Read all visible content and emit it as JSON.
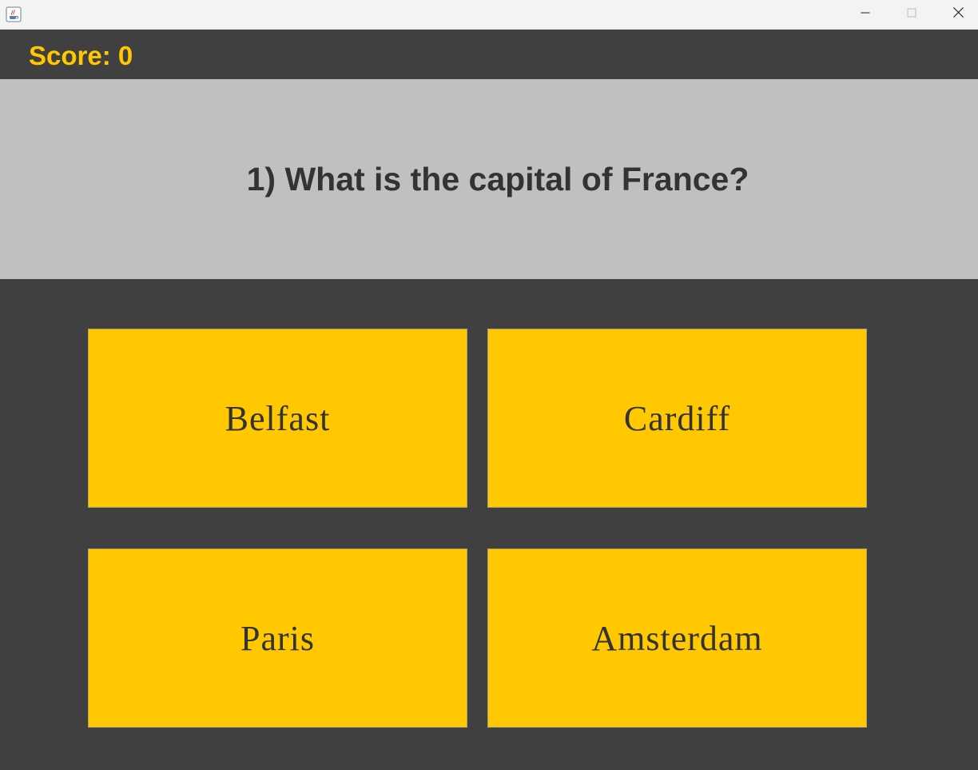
{
  "window": {
    "app_icon": "java-coffee-icon",
    "controls": {
      "minimize_icon": "minimize-icon",
      "maximize_icon": "maximize-icon",
      "close_icon": "close-icon"
    }
  },
  "score": {
    "label": "Score: 0"
  },
  "question": {
    "text": "1) What is the capital of France?"
  },
  "answers": [
    {
      "label": "Belfast"
    },
    {
      "label": "Cardiff"
    },
    {
      "label": "Paris"
    },
    {
      "label": "Amsterdam"
    }
  ],
  "colors": {
    "background": "#404040",
    "accent": "#ffc800",
    "question_panel": "#c0c0c0",
    "text_dark": "#333333"
  }
}
